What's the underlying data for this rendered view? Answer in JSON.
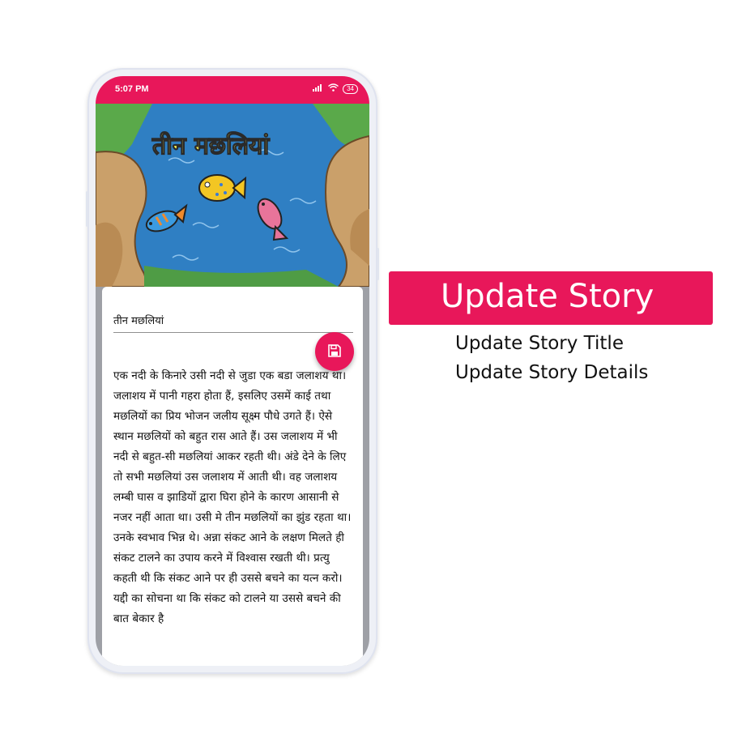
{
  "status_bar": {
    "time": "5:07 PM",
    "battery": "34"
  },
  "banner": {
    "image_title": "तीन मछलियां",
    "colors": {
      "water": "#2f7fc3",
      "grass": "#5aa94a",
      "bank": "#caa06a"
    }
  },
  "story": {
    "title_value": "तीन मछलियां",
    "details": "एक नदी के किनारे उसी नदी से जुडा एक बडा जलाशय था। जलाशय में पानी गहरा होता हैं, इसलिए उसमें काई तथा मछलियों का प्रिय भोजन जलीय सूक्ष्म पौधे उगते हैं। ऐसे स्थान मछलियों को बहुत रास आते हैं। उस जलाशय में भी नदी से बहुत-सी मछलियां आकर रहती थी। अंडे देने के लिए तो सभी मछलियां उस जलाशय में आती थी। वह जलाशय लम्बी घास व झाडियों द्वारा घिरा होने के कारण आसानी से नजर नहीं आता था। उसी मे तीन मछलियों का झुंड रहता था। उनके स्वभाव भिन्न थे। अन्ना संकट आने के लक्षण मिलते ही संकट टालने का उपाय करने में विश्वास रखती थी। प्रत्यु कहती थी कि संकट आने पर ही उससे बचने का यत्न करो। यद्दी का सोचना था कि संकट को टालने या उससे बचने की बात बेकार है"
  },
  "fab": {
    "icon": "save-icon"
  },
  "promo": {
    "headline": "Update Story",
    "features": [
      "Update Story Title",
      "Update Story Details"
    ]
  },
  "colors": {
    "accent": "#e8175a",
    "content_gray": "#9ea0a6"
  }
}
